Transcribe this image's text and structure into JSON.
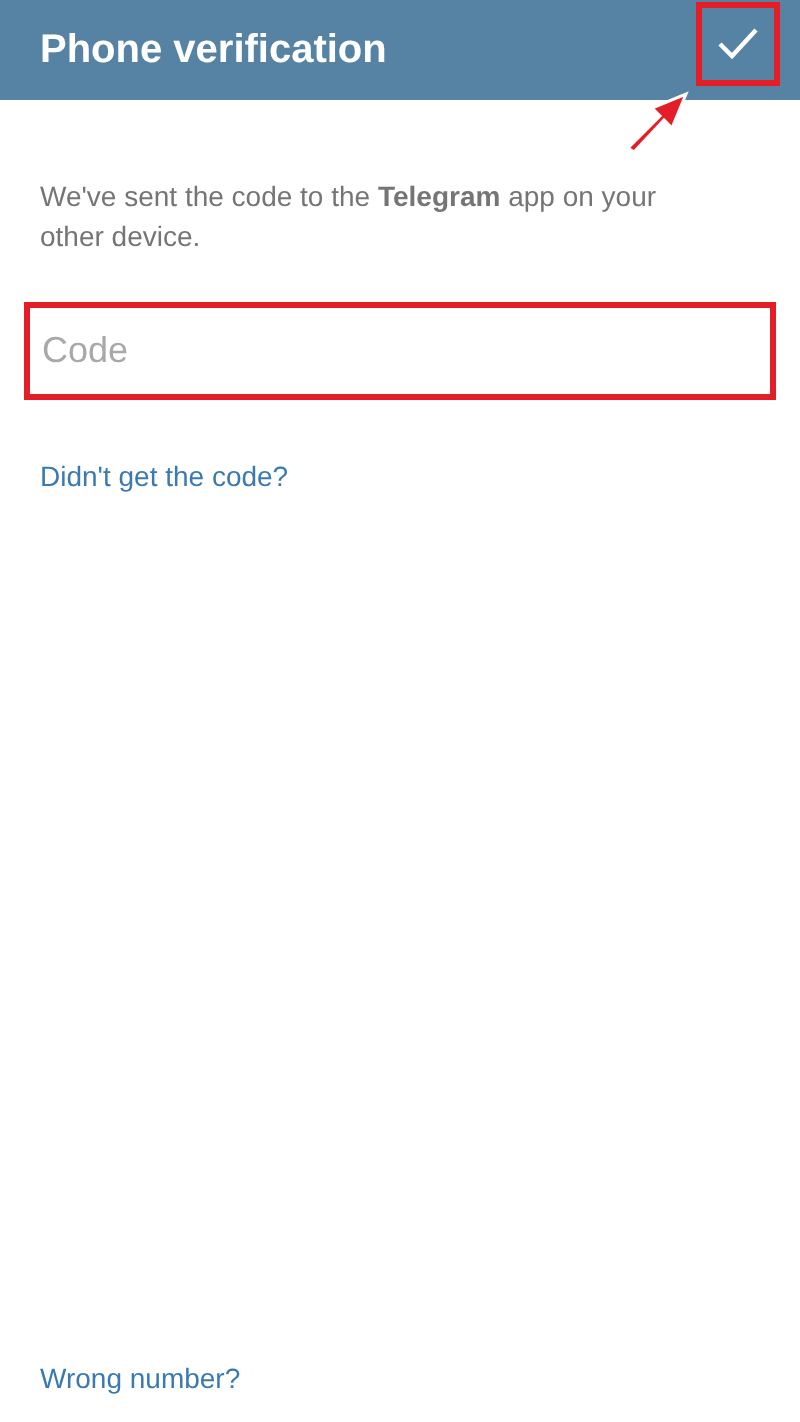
{
  "header": {
    "title": "Phone verification"
  },
  "message": "We've sent the code to the **Telegram** app on your other device.",
  "code_field": {
    "placeholder": "Code"
  },
  "links": [
    "Didn't get the code?"
  ],
  "footer_link": "Wrong number?"
}
